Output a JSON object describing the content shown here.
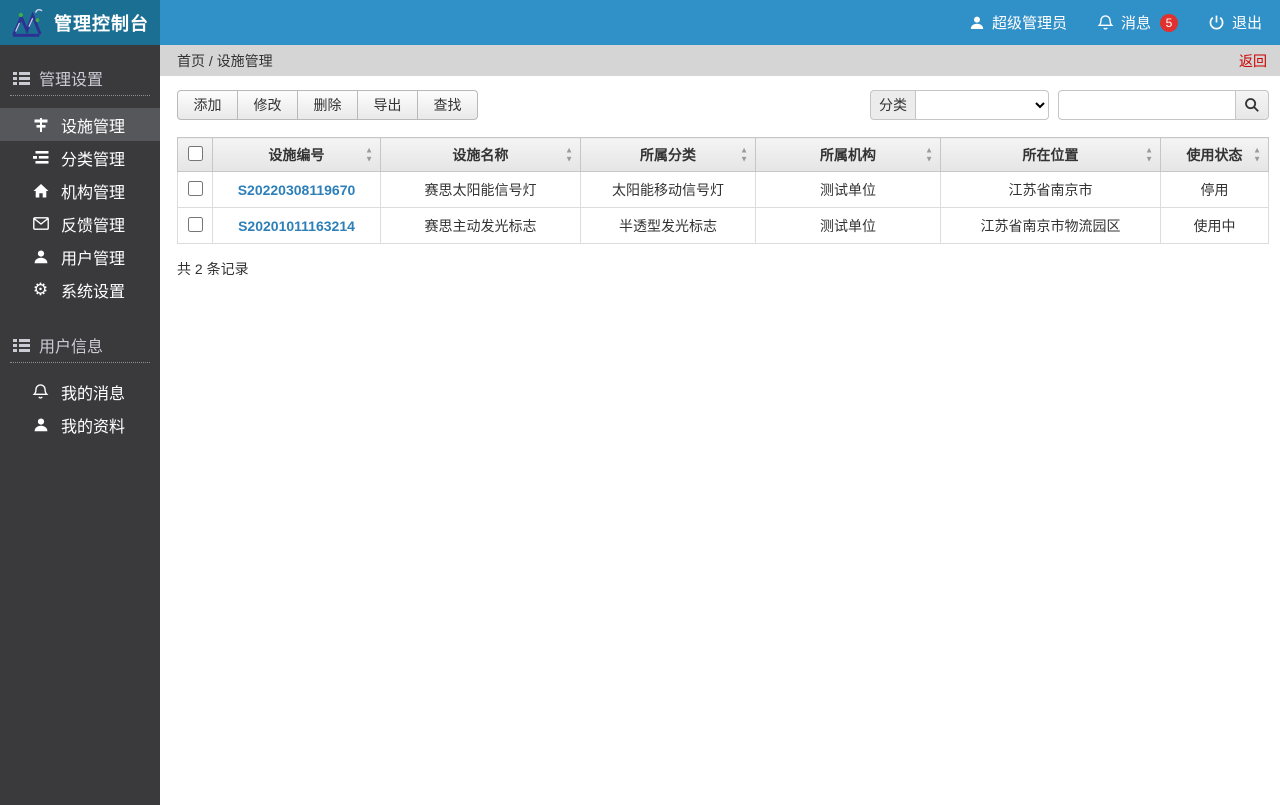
{
  "header": {
    "title": "管理控制台",
    "user_label": "超级管理员",
    "messages_label": "消息",
    "messages_badge": "5",
    "logout_label": "退出"
  },
  "breadcrumb": {
    "path": "首页 / 设施管理",
    "back_label": "返回"
  },
  "sidebar": {
    "sections": [
      {
        "title": "管理设置",
        "items": [
          {
            "label": "设施管理",
            "icon": "signpost-icon",
            "active": true
          },
          {
            "label": "分类管理",
            "icon": "category-list-icon",
            "active": false
          },
          {
            "label": "机构管理",
            "icon": "home-icon",
            "active": false
          },
          {
            "label": "反馈管理",
            "icon": "envelope-icon",
            "active": false
          },
          {
            "label": "用户管理",
            "icon": "user-icon",
            "active": false
          },
          {
            "label": "系统设置",
            "icon": "gear-icon",
            "active": false
          }
        ]
      },
      {
        "title": "用户信息",
        "items": [
          {
            "label": "我的消息",
            "icon": "bell-icon",
            "active": false
          },
          {
            "label": "我的资料",
            "icon": "user-icon",
            "active": false
          }
        ]
      }
    ]
  },
  "toolbar": {
    "add_label": "添加",
    "edit_label": "修改",
    "delete_label": "删除",
    "export_label": "导出",
    "find_label": "查找",
    "category_label": "分类",
    "category_selected": "",
    "search_value": ""
  },
  "table": {
    "columns": [
      "设施编号",
      "设施名称",
      "所属分类",
      "所属机构",
      "所在位置",
      "使用状态"
    ],
    "rows": [
      {
        "id": "S20220308119670",
        "name": "赛思太阳能信号灯",
        "category": "太阳能移动信号灯",
        "org": "测试单位",
        "location": "江苏省南京市",
        "status": "停用"
      },
      {
        "id": "S20201011163214",
        "name": "赛思主动发光标志",
        "category": "半透型发光标志",
        "org": "测试单位",
        "location": "江苏省南京市物流园区",
        "status": "使用中"
      }
    ],
    "summary": "共 2 条记录"
  },
  "colors": {
    "topbar_blue": "#3090c8",
    "logo_teal": "#1b6f93",
    "sidebar_dark": "#3a3a3c",
    "sidebar_active": "#56575b",
    "breadcrumb_gray": "#d5d5d5",
    "back_red": "#cc0000",
    "link_blue": "#2d7fb8",
    "badge_red": "#e0312e"
  }
}
